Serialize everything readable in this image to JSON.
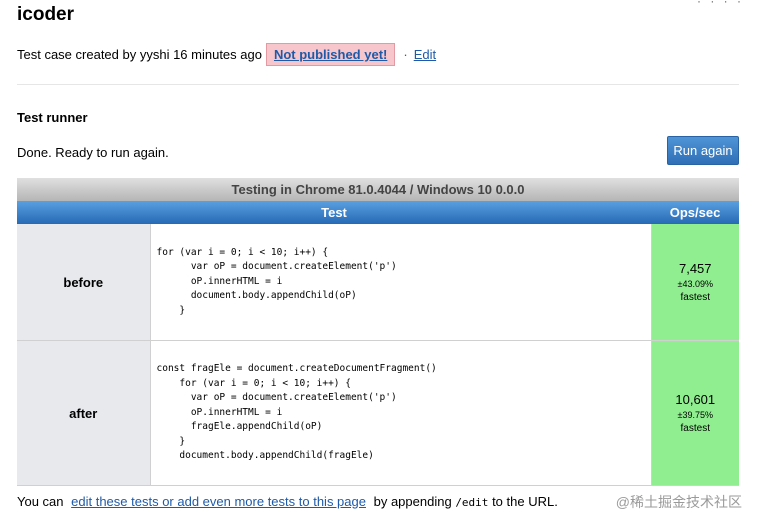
{
  "page": {
    "title": "icoder",
    "top_right_glyphs": "· · · ·"
  },
  "meta": {
    "created": "Test case created by yyshi 16 minutes ago",
    "badge": "Not published yet!",
    "separator": "·",
    "edit": "Edit"
  },
  "runner": {
    "title": "Test runner",
    "status": "Done. Ready to run again.",
    "button": "Run again"
  },
  "results": {
    "caption": "Testing in Chrome 81.0.4044 / Windows 10 0.0.0",
    "col_test": "Test",
    "col_ops": "Ops/sec",
    "rows": [
      {
        "name": "before",
        "code": "for (var i = 0; i < 10; i++) {\n      var oP = document.createElement('p')\n      oP.innerHTML = i\n      document.body.appendChild(oP)\n    }",
        "ops": "7,457",
        "err": "±43.09%",
        "rank": "fastest"
      },
      {
        "name": "after",
        "code": "const fragEle = document.createDocumentFragment()\n    for (var i = 0; i < 10; i++) {\n      var oP = document.createElement('p')\n      oP.innerHTML = i\n      fragEle.appendChild(oP)\n    }\n    document.body.appendChild(fragEle)",
        "ops": "10,601",
        "err": "±39.75%",
        "rank": "fastest"
      }
    ],
    "colors": {
      "header_blue": "#2669b5",
      "fastest_green": "#90ee90",
      "name_bg": "#e7e9ed"
    }
  },
  "footer": {
    "prefix": "You can",
    "link": "edit these tests or add even more tests to this page",
    "middle": "by appending",
    "code": "/edit",
    "suffix": "to the URL."
  },
  "watermark": "@稀土掘金技术社区"
}
